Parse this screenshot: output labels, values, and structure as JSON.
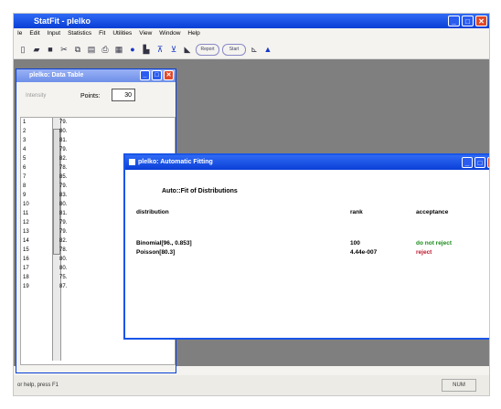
{
  "app": {
    "title": "StatFit - plelko",
    "menu": [
      "Ie",
      "Edit",
      "Input",
      "Statistics",
      "Fit",
      "Utilities",
      "View",
      "Window",
      "Help"
    ],
    "toolbar_icons": [
      "new-file-icon",
      "open-folder-icon",
      "save-icon",
      "cut-icon",
      "copy-icon",
      "paste-icon",
      "print-icon",
      "chart-icon",
      "circle-icon",
      "histogram-icon",
      "pdf-icon",
      "cdf-icon",
      "ks-icon",
      "report-pill",
      "start-pill",
      "fit-line-icon",
      "triangle-icon"
    ],
    "toolbar_pills": [
      "Report",
      "Start"
    ]
  },
  "data_table": {
    "title": "plelko: Data Table",
    "attribute_label": "Intensity",
    "points_label": "Points:",
    "points_value": "30",
    "rows": [
      {
        "idx": "1",
        "val": "79."
      },
      {
        "idx": "2",
        "val": "80."
      },
      {
        "idx": "3",
        "val": "81."
      },
      {
        "idx": "4",
        "val": "79."
      },
      {
        "idx": "5",
        "val": "82."
      },
      {
        "idx": "6",
        "val": "78."
      },
      {
        "idx": "7",
        "val": "85."
      },
      {
        "idx": "8",
        "val": "79."
      },
      {
        "idx": "9",
        "val": "83."
      },
      {
        "idx": "10",
        "val": "80."
      },
      {
        "idx": "11",
        "val": "81."
      },
      {
        "idx": "12",
        "val": "79."
      },
      {
        "idx": "13",
        "val": "79."
      },
      {
        "idx": "14",
        "val": "82."
      },
      {
        "idx": "15",
        "val": "78."
      },
      {
        "idx": "16",
        "val": "80."
      },
      {
        "idx": "17",
        "val": "80."
      },
      {
        "idx": "18",
        "val": "75."
      },
      {
        "idx": "19",
        "val": "87."
      }
    ]
  },
  "fitting": {
    "title": "plelko: Automatic Fitting",
    "heading": "Auto::Fit of Distributions",
    "columns": {
      "distribution": "distribution",
      "rank": "rank",
      "acceptance": "acceptance"
    },
    "rows": [
      {
        "distribution": "Binomial[96., 0.853]",
        "rank": "100",
        "acceptance": "do not reject",
        "color": "#1a8a1a"
      },
      {
        "distribution": "Poisson[80.3]",
        "rank": "4.44e-007",
        "acceptance": "reject",
        "color": "#c0142a"
      }
    ]
  },
  "status": {
    "left": "or help, press F1",
    "right": "NUM"
  }
}
